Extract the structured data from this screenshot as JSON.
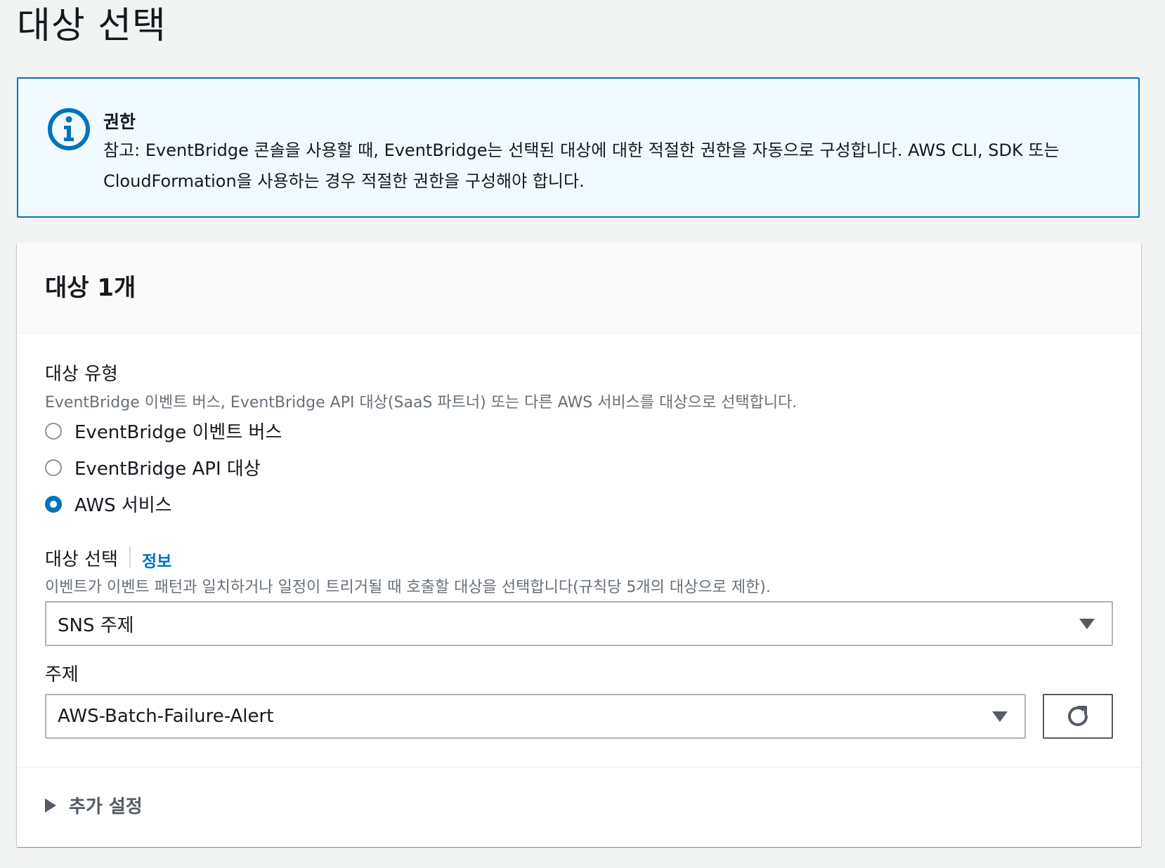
{
  "page": {
    "title": "대상 선택"
  },
  "alert": {
    "icon": "info-icon",
    "title": "권한",
    "body": "참고: EventBridge 콘솔을 사용할 때, EventBridge는 선택된 대상에 대한 적절한 권한을 자동으로 구성합니다. AWS CLI, SDK 또는 CloudFormation을 사용하는 경우 적절한 권한을 구성해야 합니다."
  },
  "card": {
    "title": "대상 1개",
    "target_type": {
      "label": "대상 유형",
      "description": "EventBridge 이벤트 버스, EventBridge API 대상(SaaS 파트너) 또는 다른 AWS 서비스를 대상으로 선택합니다.",
      "options": [
        {
          "label": "EventBridge 이벤트 버스",
          "checked": false
        },
        {
          "label": "EventBridge API 대상",
          "checked": false
        },
        {
          "label": "AWS 서비스",
          "checked": true
        }
      ]
    },
    "target_select": {
      "label": "대상 선택",
      "info_link": "정보",
      "description": "이벤트가 이벤트 패턴과 일치하거나 일정이 트리거될 때 호출할 대상을 선택합니다(규칙당 5개의 대상으로 제한).",
      "value": "SNS 주제"
    },
    "topic": {
      "label": "주제",
      "value": "AWS-Batch-Failure-Alert",
      "refresh_icon": "refresh-icon"
    },
    "additional_settings": {
      "label": "추가 설정"
    }
  },
  "colors": {
    "accent": "#0073bb",
    "alert_bg": "#f1faff",
    "page_bg": "#f2f3f3",
    "text": "#16191f",
    "muted_text": "#687078"
  }
}
